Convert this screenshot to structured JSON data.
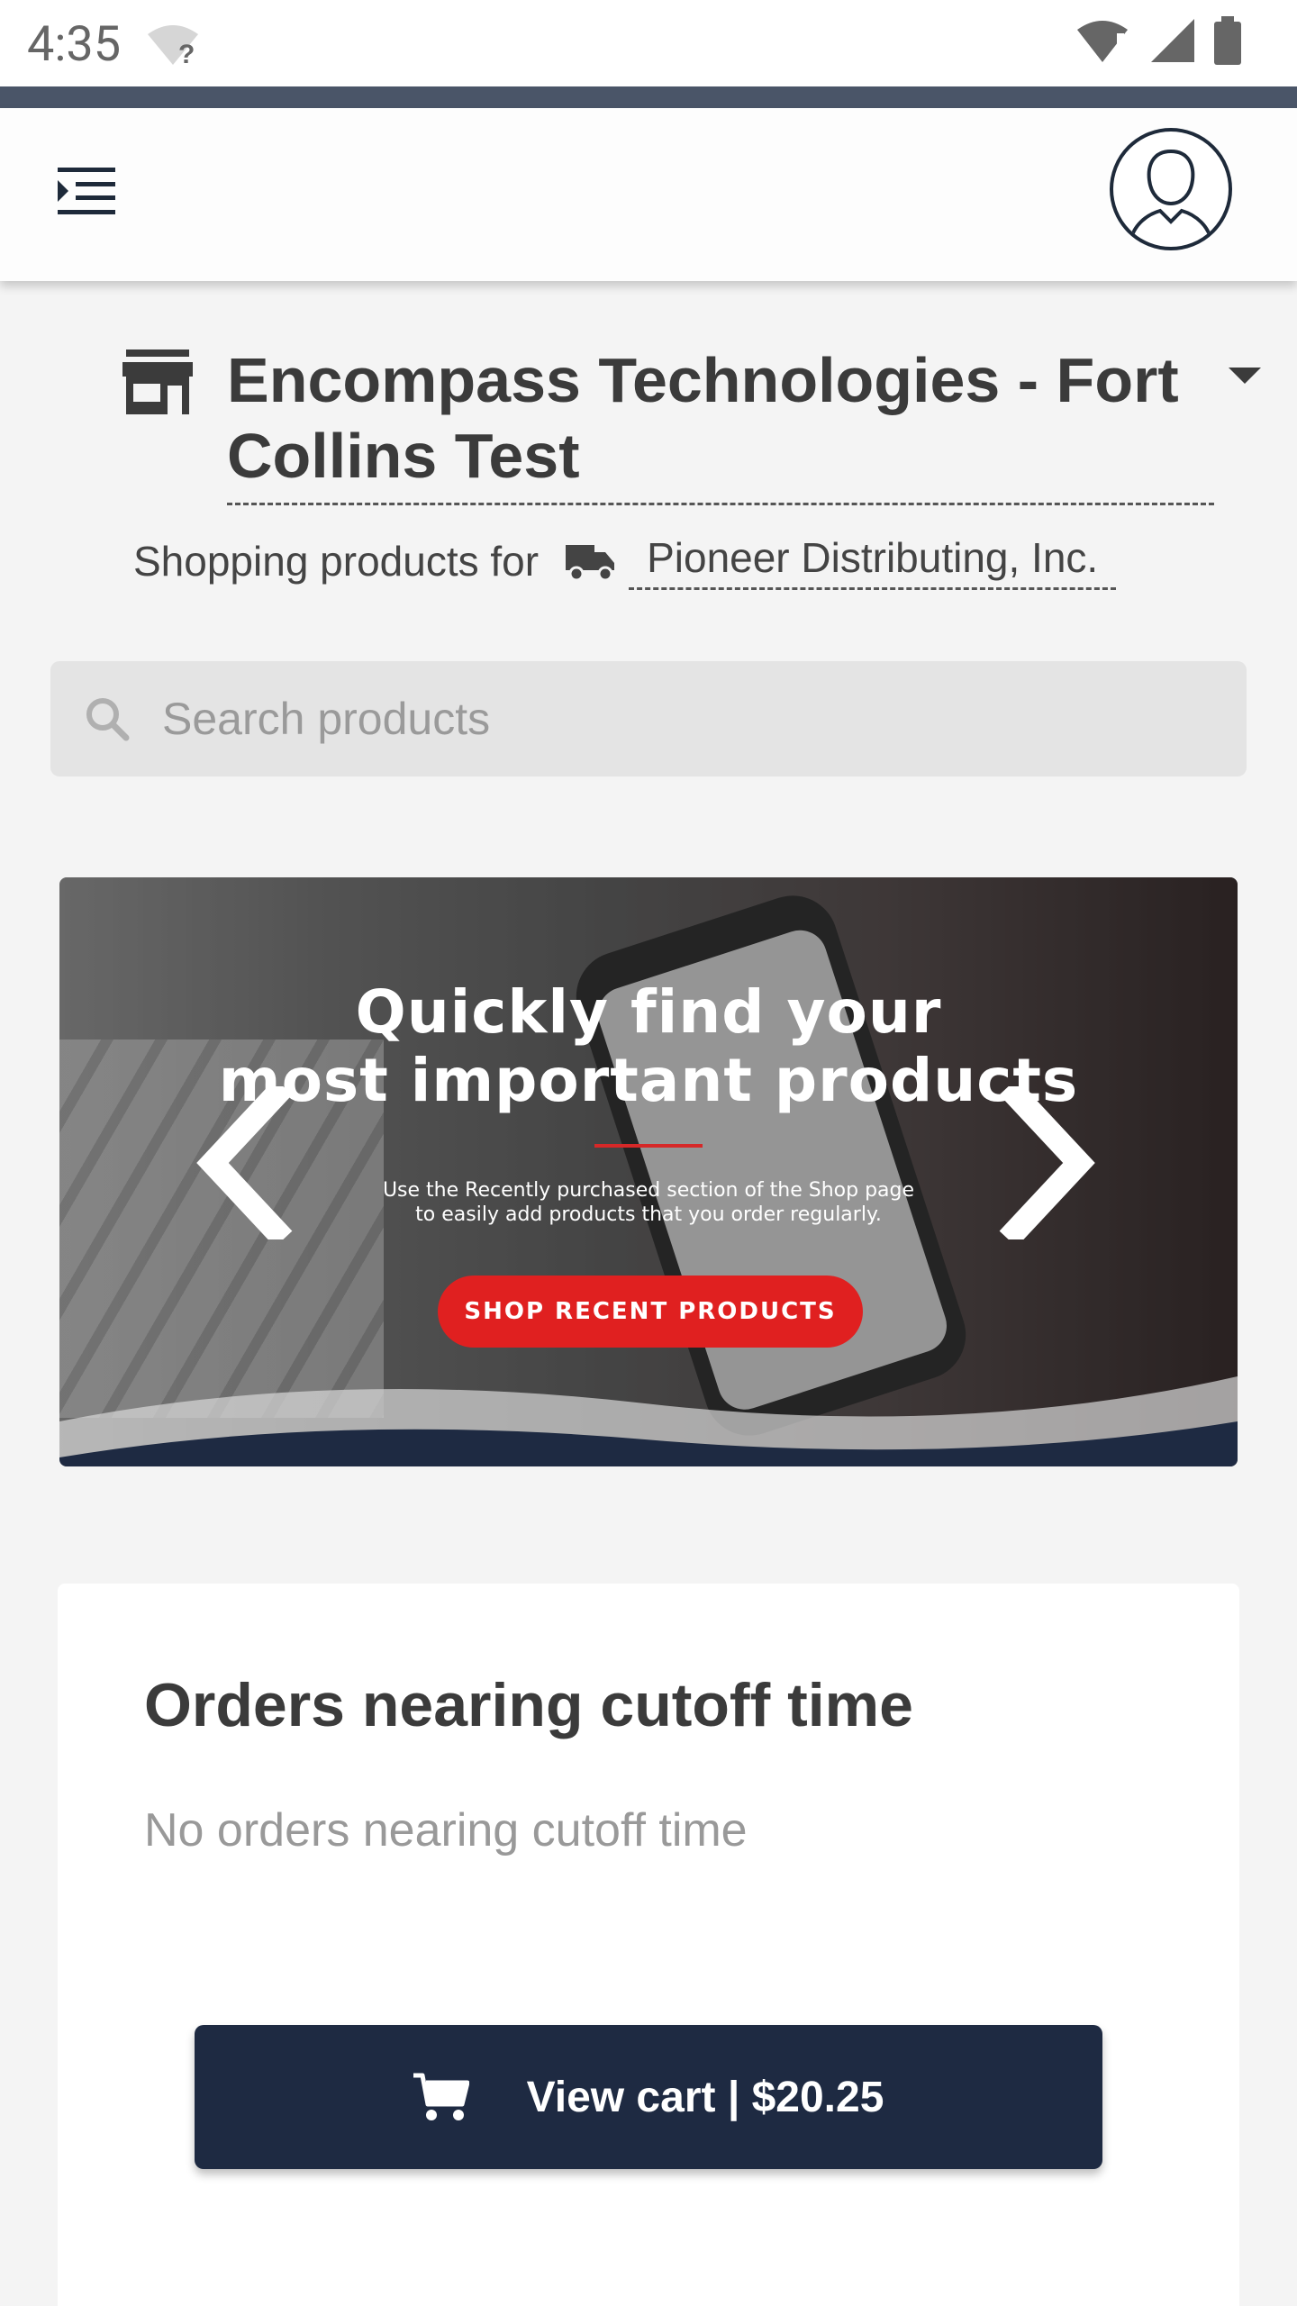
{
  "status_bar": {
    "time": "4:35"
  },
  "header": {
    "menu_icon": "menu-indent-icon",
    "avatar_icon": "user-avatar-icon"
  },
  "store": {
    "name": "Encompass Technologies - Fort Collins Test",
    "icon": "storefront-icon"
  },
  "shopping_for": {
    "label": "Shopping products for",
    "customer": "Pioneer Distributing, Inc.",
    "icon": "truck-icon"
  },
  "search": {
    "placeholder": "Search products"
  },
  "banner": {
    "headline_line1": "Quickly find your",
    "headline_line2": "most important products",
    "subtext_line1": "Use the Recently purchased section of the Shop page",
    "subtext_line2": "to easily add products that you order regularly.",
    "cta": "SHOP RECENT PRODUCTS"
  },
  "orders_card": {
    "title": "Orders nearing cutoff time",
    "empty_message": "No orders nearing cutoff time"
  },
  "cart_button": {
    "label": "View cart | $20.25"
  },
  "colors": {
    "navy": "#1e2a42",
    "accent_red": "#e02020",
    "background": "#f4f4f4"
  }
}
